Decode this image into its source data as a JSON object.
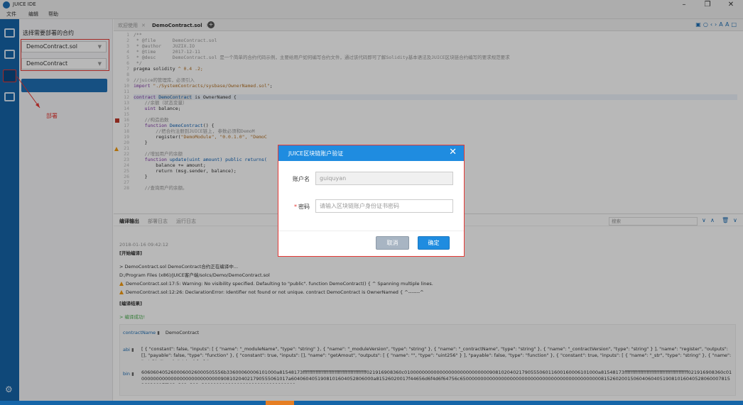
{
  "app": {
    "title": "JUICE IDE"
  },
  "menu": [
    "文件",
    "编辑",
    "帮助"
  ],
  "window_controls": [
    "–",
    "❐",
    "✕"
  ],
  "deploy": {
    "title": "选择需要部署的合约",
    "file_select": "DemoContract.sol",
    "contract_select": "DemoContract",
    "annotation": "部署"
  },
  "editor": {
    "tabs": [
      {
        "label": "欢迎使用"
      },
      {
        "label": "DemoContract.sol"
      }
    ],
    "lines": [
      "1",
      "2",
      "3",
      "4",
      "5",
      "6",
      "7",
      "8",
      "9",
      "10",
      "11",
      "12",
      "13",
      "14",
      "15",
      "16",
      "17",
      "18",
      "19",
      "20",
      "21",
      "22",
      "23",
      "24",
      "25",
      "26",
      "27",
      "28"
    ]
  },
  "code": {
    "l1": "/**",
    "l2": " * @file      DemoContract.sol",
    "l3": " * @author    JUZIX.IO",
    "l4": " * @time      2017-12-11",
    "l5": " * @desc      DemoContract.sol 是一个简单的合约代码示例，主要给用户如何编写合约文件，通过该代码即可了解Solidity基本语法及JUICE区块链合约编写的要求规范要求",
    "l6": " */",
    "l7a": "pragma solidity ",
    "l7b": "^ 0.4 .2;",
    "l9": "//juice的管理库，必须引入",
    "l10a": "import ",
    "l10b": "\"./SystemContracts/sysbase/OwnerNamed.sol\"",
    "l10c": ";",
    "l12a": "contract ",
    "l12b": "DemoContract",
    "l12c": " is OwnerNamed {",
    "l13": "    //余额（状态变量）",
    "l14a": "    uint ",
    "l14b": "balance;",
    "l16": "    //构造函数",
    "l17a": "    function ",
    "l17b": "DemoContract",
    "l17c": "() {",
    "l18": "        //把合约注册到JUICE链上, 参数必须和DemoM",
    "l19a": "        register(",
    "l19b": "\"DemoModule\", \"0.0.1.0\", \"DemoC",
    "l20": "    }",
    "l22": "    //增加用户的余额",
    "l23a": "    function ",
    "l23b": "update(uint amount) public returns(",
    "l24": "        balance += amount;",
    "l25": "        return (msg.sender, balance);",
    "l26": "    }",
    "l28": "    //查询用户的余额。"
  },
  "panel": {
    "tabs": [
      "编译输出",
      "部署日志",
      "运行日志"
    ],
    "search_placeholder": "搜索",
    "timestamp": "2018-01-16 09:42:12",
    "start": "[开始编译]",
    "compiling": "> DemoContract.sol DemoContract合约正在编译中...",
    "path": "D:/Program Files (x86)/JUICE客户端/solcs/Demo/DemoContract.sol",
    "warn1": "DemoContract.sol:17:5: Warning: No visibility specified. Defaulting to \"public\". function DemoContract() { ^ Spanning multiple lines.",
    "warn2": "DemoContract.sol:12:26: DeclarationError: Identifier not found or not unique. contract DemoContract is OwnerNamed { ^-------^",
    "result": "[编译结果]",
    "success": "> 编译成功!",
    "contract_label": "contractName",
    "contract_value": "DemoContract",
    "abi_label": "abi",
    "abi_value": "[ { \"constant\": false, \"inputs\": [ { \"name\": \"_moduleName\", \"type\": \"string\" }, { \"name\": \"_moduleVersion\", \"type\": \"string\" }, { \"name\": \"_contractName\", \"type\": \"string\" }, { \"name\": \"_contractVersion\", \"type\": \"string\" } ], \"name\": \"register\", \"outputs\": [], \"payable\": false, \"type\": \"function\" }, { \"constant\": true, \"inputs\": [], \"name\": \"getAmout\", \"outputs\": [ { \"name\": \"\", \"type\": \"uint256\" } ], \"payable\": false, \"type\": \"function\" }, { \"constant\": true, \"inputs\": [ { \"name\": \"_str\", \"type\": \"string\" }, { \"name\": \"_str2\", \"type\": \"string\" }, { \"nam",
    "bin_label": "bin",
    "bin_value": "6060604052600060026000505556b33600060006101000a81548173ffffffffffffffffffffffffffffffffffffffff021916908360c010000000000000000000000000009081020402179055506011600160006101000a81548173ffffffffffffffffffffffffffffffffffffffff021916908360c0100000000000000000000000000090810204021790555061017a6040604051908101604052806000a81526020017f44656d6f4d6f64756c6500000000000000000000000000000000000000000000008152602001506040604051908101604052806000781526020017f302e302e312e30000000000000000000000000000000"
  },
  "dialog": {
    "title": "JUICE区块链账户验证",
    "account_label": "账户名",
    "account_value": "guiquyan",
    "password_required": "*",
    "password_label": "密码",
    "password_placeholder": "请输入区块链账户身份证书密码",
    "cancel_label": "取消",
    "ok_label": "确定"
  }
}
